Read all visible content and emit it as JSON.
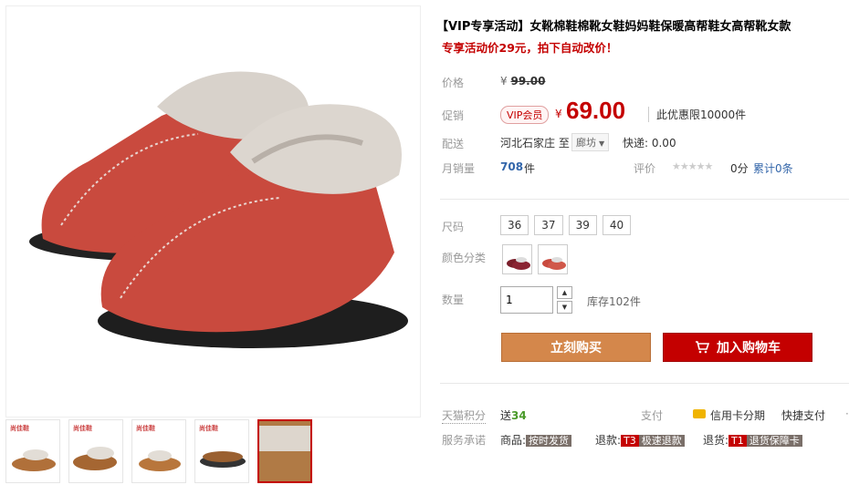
{
  "product": {
    "title": "【VIP专享活动】女靴棉鞋棉靴女鞋妈妈鞋保暖高帮鞋女高帮靴女款",
    "subtitle": "专享活动价29元，拍下自动改价！"
  },
  "price": {
    "label": "价格",
    "currency": "¥",
    "original": "99.00"
  },
  "promo": {
    "label": "促销",
    "badge": "VIP会员",
    "currency": "¥",
    "value": "69.00",
    "limit": "此优惠限10000件"
  },
  "shipping": {
    "label": "配送",
    "from": "河北石家庄",
    "to_word": "至",
    "to": "廊坊",
    "express": "快递: 0.00"
  },
  "sales": {
    "label": "月销量",
    "count": "708",
    "unit": "件",
    "rating_label": "评价",
    "stars": "★★★★★",
    "score": "0分",
    "reviews": "累计0条"
  },
  "options": {
    "size_label": "尺码",
    "sizes": [
      "36",
      "37",
      "39",
      "40"
    ],
    "color_label": "颜色分类",
    "qty_label": "数量",
    "qty_value": "1",
    "stock": "库存102件"
  },
  "actions": {
    "buy": "立刻购买",
    "cart": "加入购物车"
  },
  "footer": {
    "points_label": "天猫积分",
    "points_prefix": "送",
    "points_value": "34",
    "pay_label": "支付",
    "credit": "信用卡分期",
    "quickpay": "快捷支付",
    "promise_label": "服务承诺",
    "goods_prefix": "商品:",
    "goods_tag": "按时发货",
    "refund_prefix": "退款:",
    "refund_code": "T3",
    "refund_tag": "极速退款",
    "return_prefix": "退货:",
    "return_code": "T1",
    "return_tag": "退货保障卡"
  },
  "thumbs": {
    "brand": "尚佳鞋"
  },
  "colors": {
    "accent": "#c40000",
    "buy_button": "#d4874b",
    "shoe_red": "#c94a3e",
    "shoe_brown": "#b0703a",
    "fur": "#d8d2cb"
  }
}
